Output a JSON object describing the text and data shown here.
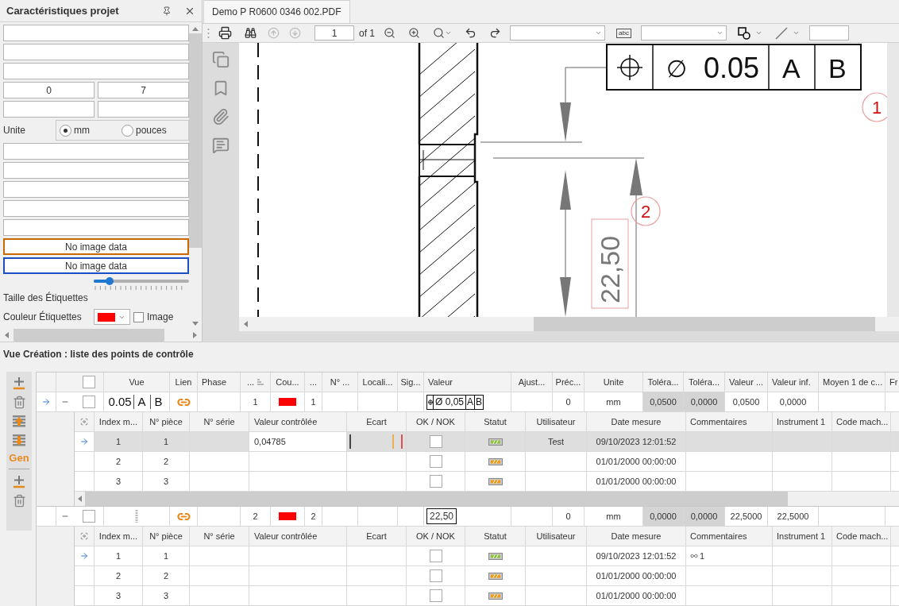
{
  "left_panel": {
    "title": "Caractéristiques projet",
    "fields": [
      {
        "kind": "text"
      },
      {
        "kind": "text"
      },
      {
        "kind": "text"
      },
      {
        "kind": "pair",
        "values": [
          "0",
          "7"
        ]
      },
      {
        "kind": "pair"
      },
      {
        "kind": "radio",
        "label": "Unite",
        "options": [
          {
            "label": "mm",
            "selected": true
          },
          {
            "label": "pouces",
            "selected": false
          }
        ]
      },
      {
        "kind": "text"
      },
      {
        "kind": "text"
      },
      {
        "kind": "text"
      },
      {
        "kind": "text"
      },
      {
        "kind": "text"
      },
      {
        "kind": "image",
        "value": "No image data",
        "color": "#c86a00"
      },
      {
        "kind": "image",
        "value": "No image data",
        "color": "#1d4fc4"
      },
      {
        "kind": "slider",
        "label": "Taille des Étiquettes",
        "level": 0.17
      },
      {
        "kind": "color",
        "label": "Couleur Étiquettes",
        "color": "#ff0000",
        "checkbox": {
          "label": "Image",
          "checked": false
        }
      }
    ]
  },
  "document": {
    "tab": {
      "label": "Demo P R0600 0346 002.PDF",
      "selected": true
    },
    "toolbar": {
      "page": "1",
      "page_count": "of 1",
      "previous_disabled": true,
      "next_disabled": true,
      "text_tool": "abc"
    },
    "drawing": {
      "frame": {
        "diameter": "∅",
        "tolerance": "0.05",
        "datums": [
          "A",
          "B"
        ]
      },
      "balloons": [
        "1",
        "2"
      ],
      "dimension": "22,50"
    }
  },
  "grid": {
    "title": "Vue Création : liste des points de contrôle",
    "toolbar_text": "Gen",
    "all_checked": false,
    "columns": [
      "Vue",
      "Lien",
      "Phase",
      "...",
      "Cou...",
      "...",
      "N° ...",
      "Locali...",
      "Sig...",
      "Valeur",
      "Ajust...",
      "Préc...",
      "Unite",
      "Toléra...",
      "Toléra...",
      "Valeur ...",
      "Valeur inf.",
      "Moyen 1 de c...",
      "Fr"
    ],
    "rows": [
      {
        "focused": true,
        "expanded": true,
        "checked": false,
        "vue": {
          "kind": "frame",
          "tolerance": "0.05",
          "datums": [
            "A",
            "B"
          ]
        },
        "order": "1",
        "color": "#ff0000",
        "number": "1",
        "valeur": {
          "kind": "frame",
          "diameter": "Ø",
          "tolerance": "0,05",
          "datums": [
            "A",
            "B"
          ]
        },
        "precision": "0",
        "unit": "mm",
        "tol_sup": "0,0500",
        "tol_inf": "0,0000",
        "val_sup": "0,0500",
        "val_inf": "0,0000",
        "columns": [
          "Index m...",
          "N° pièce",
          "N° série",
          "Valeur contrôlée",
          "Ecart",
          "OK / NOK",
          "Statut",
          "Utilisateur",
          "Date mesure",
          "Commentaires",
          "Instrument 1",
          "Code mach..."
        ],
        "measures": [
          {
            "focused": true,
            "selected": true,
            "index": "1",
            "piece": "1",
            "value": "0,04785",
            "gauge": true,
            "checked": false,
            "color": "#8cc63f",
            "user": "Test",
            "date": "09/10/2023 12:01:52"
          },
          {
            "focused": false,
            "selected": false,
            "index": "2",
            "piece": "2",
            "gauge": false,
            "checked": false,
            "color": "#f39c12",
            "date": "01/01/2000 00:00:00"
          },
          {
            "focused": false,
            "selected": false,
            "index": "3",
            "piece": "3",
            "gauge": false,
            "checked": false,
            "color": "#f39c12",
            "date": "01/01/2000 00:00:00"
          }
        ]
      },
      {
        "focused": false,
        "expanded": true,
        "checked": false,
        "vue": {
          "kind": "dimension"
        },
        "order": "2",
        "color": "#ff0000",
        "number": "2",
        "valeur": {
          "kind": "dimension",
          "text": "22,50"
        },
        "precision": "0",
        "unit": "mm",
        "tol_sup": "0,0000",
        "tol_inf": "0,0000",
        "val_sup": "22,5000",
        "val_inf": "22,5000",
        "columns": [
          "Index m...",
          "N° pièce",
          "N° série",
          "Valeur contrôlée",
          "Ecart",
          "OK / NOK",
          "Statut",
          "Utilisateur",
          "Date mesure",
          "Commentaires",
          "Instrument 1",
          "Code mach..."
        ],
        "measures": [
          {
            "focused": true,
            "selected": false,
            "index": "1",
            "piece": "1",
            "gauge": false,
            "checked": false,
            "color": "#8cc63f",
            "date": "09/10/2023 12:01:52",
            "comment": "1"
          },
          {
            "focused": false,
            "selected": false,
            "index": "2",
            "piece": "2",
            "gauge": false,
            "checked": false,
            "color": "#f39c12",
            "date": "01/01/2000 00:00:00"
          },
          {
            "focused": false,
            "selected": false,
            "index": "3",
            "piece": "3",
            "gauge": false,
            "checked": false,
            "color": "#f39c12",
            "date": "01/01/2000 00:00:00"
          }
        ]
      }
    ]
  }
}
